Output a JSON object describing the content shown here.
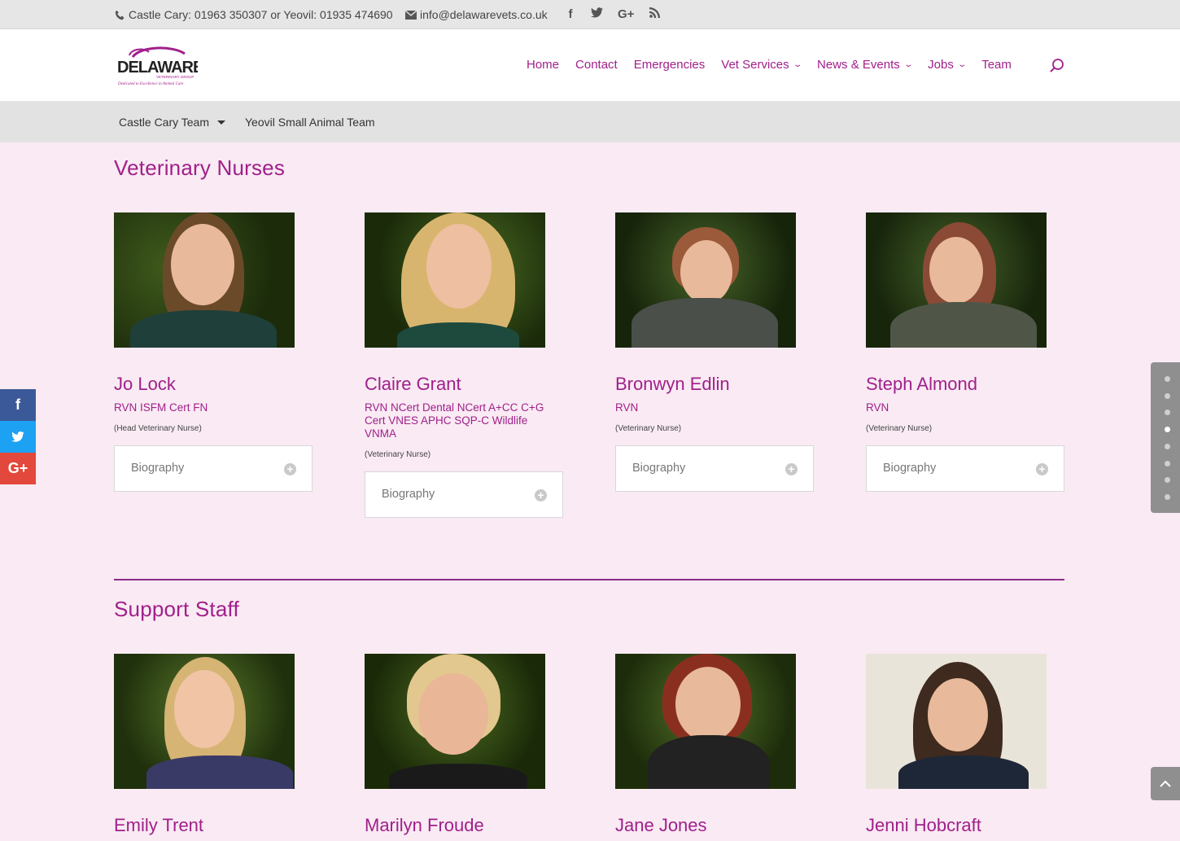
{
  "topbar": {
    "phone": "Castle Cary: 01963 350307 or Yeovil: 01935 474690",
    "email": "info@delawarevets.co.uk",
    "socials": [
      "f",
      "t",
      "G+",
      "rss"
    ]
  },
  "logo": {
    "text": "DELAWARE",
    "sub": "VETERINARY GROUP",
    "tagline": "Dedicated to Excellence in Animal Care"
  },
  "nav": {
    "items": [
      {
        "label": "Home"
      },
      {
        "label": "Contact"
      },
      {
        "label": "Emergencies"
      },
      {
        "label": "Vet Services",
        "dropdown": true
      },
      {
        "label": "News & Events",
        "dropdown": true
      },
      {
        "label": "Jobs",
        "dropdown": true
      },
      {
        "label": "Team"
      }
    ]
  },
  "subnav": {
    "items": [
      "Castle Cary Team",
      "Yeovil Small Animal Team"
    ]
  },
  "sections": {
    "nurses_title": "Veterinary Nurses",
    "support_title": "Support Staff"
  },
  "nurses": [
    {
      "name": "Jo Lock",
      "quals": "RVN ISFM Cert FN",
      "role": "(Head Veterinary Nurse)",
      "bio": "Biography"
    },
    {
      "name": "Claire Grant",
      "quals": "RVN NCert Dental NCert A+CC C+G Cert VNES APHC SQP-C Wildlife VNMA",
      "role": "(Veterinary Nurse)",
      "bio": "Biography"
    },
    {
      "name": "Bronwyn Edlin",
      "quals": "RVN",
      "role": "(Veterinary Nurse)",
      "bio": "Biography"
    },
    {
      "name": "Steph Almond",
      "quals": "RVN",
      "role": "(Veterinary Nurse)",
      "bio": "Biography"
    }
  ],
  "support": [
    {
      "name": "Emily Trent"
    },
    {
      "name": "Marilyn Froude"
    },
    {
      "name": "Jane Jones"
    },
    {
      "name": "Jenni Hobcraft"
    }
  ],
  "share": [
    "f",
    "t",
    "G+"
  ],
  "colors": {
    "accent": "#a0208b",
    "background": "#f9eaf3",
    "divider": "#8d2b8a"
  }
}
